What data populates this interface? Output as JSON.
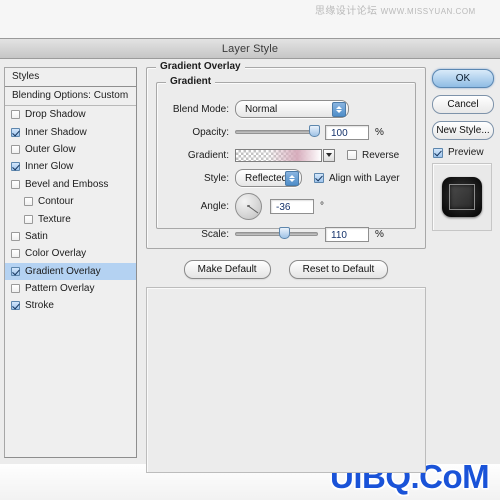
{
  "watermarks": {
    "top_cn": "思缘设计论坛",
    "top_latin": "WWW.MISSYUAN.COM",
    "bottom": "UiBQ.CoM"
  },
  "dialog": {
    "title": "Layer Style"
  },
  "styles_panel": {
    "header": "Styles",
    "blending_options": "Blending Options: Custom",
    "effects": [
      {
        "label": "Drop Shadow",
        "checked": false,
        "indent": false,
        "selected": false
      },
      {
        "label": "Inner Shadow",
        "checked": true,
        "indent": false,
        "selected": false
      },
      {
        "label": "Outer Glow",
        "checked": false,
        "indent": false,
        "selected": false
      },
      {
        "label": "Inner Glow",
        "checked": true,
        "indent": false,
        "selected": false
      },
      {
        "label": "Bevel and Emboss",
        "checked": false,
        "indent": false,
        "selected": false
      },
      {
        "label": "Contour",
        "checked": false,
        "indent": true,
        "selected": false
      },
      {
        "label": "Texture",
        "checked": false,
        "indent": true,
        "selected": false
      },
      {
        "label": "Satin",
        "checked": false,
        "indent": false,
        "selected": false
      },
      {
        "label": "Color Overlay",
        "checked": false,
        "indent": false,
        "selected": false
      },
      {
        "label": "Gradient Overlay",
        "checked": true,
        "indent": false,
        "selected": true
      },
      {
        "label": "Pattern Overlay",
        "checked": false,
        "indent": false,
        "selected": false
      },
      {
        "label": "Stroke",
        "checked": true,
        "indent": false,
        "selected": false
      }
    ]
  },
  "settings": {
    "outer_legend": "Gradient Overlay",
    "inner_legend": "Gradient",
    "blend_mode": {
      "label": "Blend Mode:",
      "value": "Normal"
    },
    "opacity": {
      "label": "Opacity:",
      "value": "100",
      "unit": "%",
      "percent": 100
    },
    "gradient": {
      "label": "Gradient:",
      "reverse_label": "Reverse",
      "reverse_checked": false
    },
    "style": {
      "label": "Style:",
      "value": "Reflected",
      "align_label": "Align with Layer",
      "align_checked": true
    },
    "angle": {
      "label": "Angle:",
      "value": "-36",
      "unit": "°",
      "degrees": -36
    },
    "scale": {
      "label": "Scale:",
      "value": "110",
      "unit": "%",
      "percent": 60
    },
    "make_default": "Make Default",
    "reset_to_default": "Reset to Default"
  },
  "actions": {
    "ok": "OK",
    "cancel": "Cancel",
    "new_style": "New Style...",
    "preview_label": "Preview",
    "preview_checked": true
  },
  "colors": {
    "accent": "#8fbce4",
    "selection": "#b4d2f2",
    "dialog_bg": "#ececec",
    "watermark_blue": "#1a53d8"
  }
}
